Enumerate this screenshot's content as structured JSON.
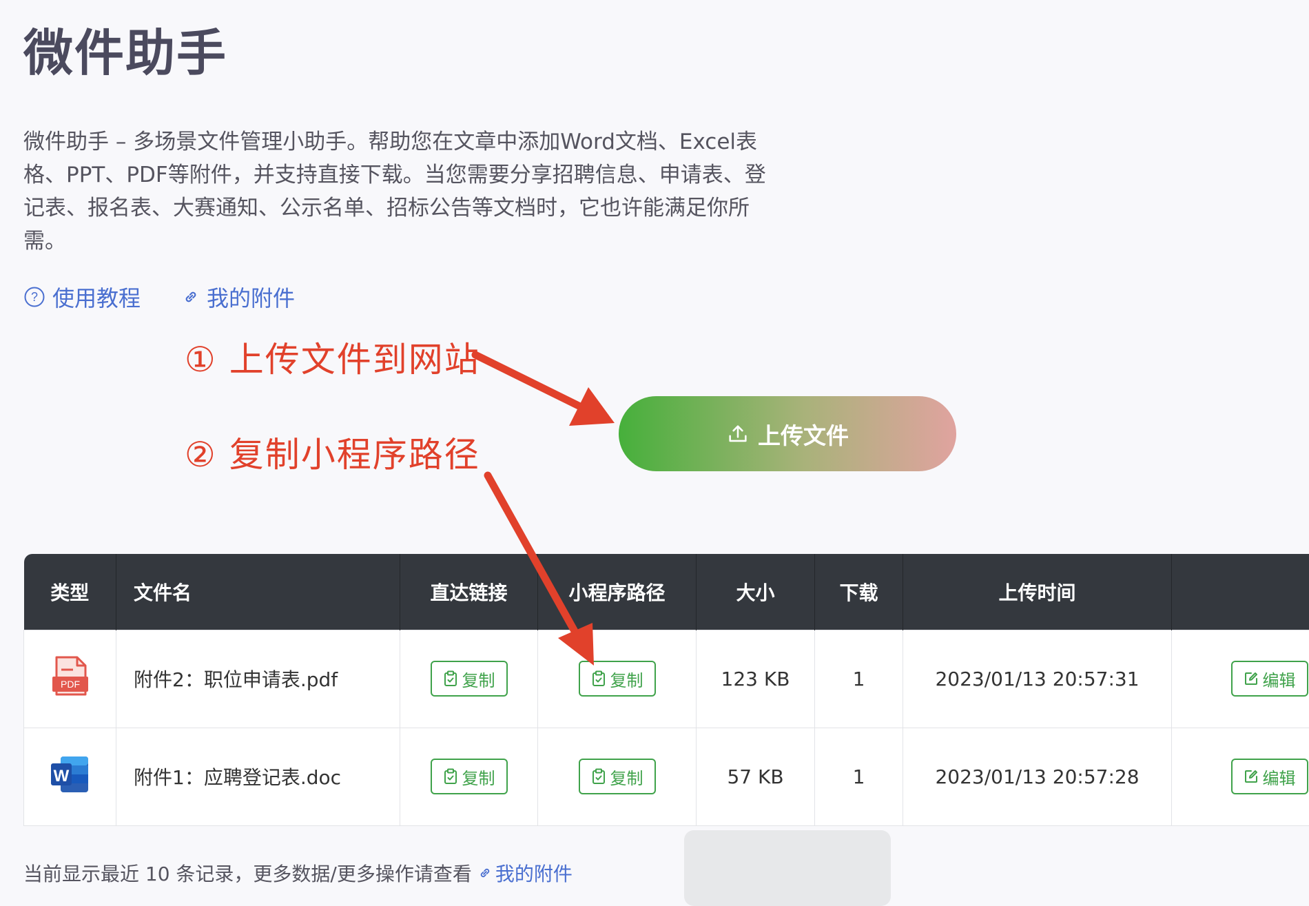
{
  "app": {
    "title": "微件助手",
    "description": "微件助手 – 多场景文件管理小助手。帮助您在文章中添加Word文档、Excel表格、PPT、PDF等附件，并支持直接下载。当您需要分享招聘信息、申请表、登记表、报名表、大赛通知、公示名单、招标公告等文档时，它也许能满足你所需。"
  },
  "links": {
    "tutorial": "使用教程",
    "my_files": "我的附件"
  },
  "annotations": {
    "step1": "① 上传文件到网站",
    "step2": "② 复制小程序路径"
  },
  "upload": {
    "label": "上传文件"
  },
  "table": {
    "headers": {
      "type": "类型",
      "name": "文件名",
      "direct_link": "直达链接",
      "mini_path": "小程序路径",
      "size": "大小",
      "downloads": "下载",
      "upload_time": "上传时间",
      "actions": ""
    },
    "rows": [
      {
        "type_icon": "pdf-file-icon",
        "type_text": "PDF",
        "name": "附件2：职位申请表.pdf",
        "copy_direct": "复制",
        "copy_path": "复制",
        "size": "123 KB",
        "downloads": "1",
        "upload_time": "2023/01/13 20:57:31",
        "edit": "编辑"
      },
      {
        "type_icon": "word-file-icon",
        "type_text": "W",
        "name": "附件1：应聘登记表.doc",
        "copy_direct": "复制",
        "copy_path": "复制",
        "size": "57 KB",
        "downloads": "1",
        "upload_time": "2023/01/13 20:57:28",
        "edit": "编辑"
      }
    ]
  },
  "footer": {
    "text": "当前显示最近 10 条记录，更多数据/更多操作请查看",
    "link": "我的附件"
  },
  "colors": {
    "accent_green": "#3fa24a",
    "link_blue": "#4a6fd0",
    "annotation_red": "#e1412b",
    "table_header": "#34383e"
  }
}
